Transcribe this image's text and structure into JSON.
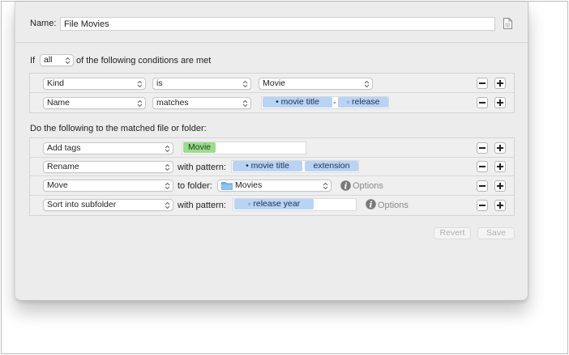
{
  "header": {
    "name_label": "Name:",
    "name_value": "File Movies",
    "doc_icon": "document-icon"
  },
  "conditions": {
    "prefix": "If",
    "match_select": "all",
    "suffix": "of the following conditions are met",
    "rows": [
      {
        "attribute": "Kind",
        "operator": "is",
        "value": "Movie"
      },
      {
        "attribute": "Name",
        "operator": "matches",
        "tokens": [
          "• movie title",
          "release"
        ],
        "separator": "-"
      }
    ]
  },
  "actions": {
    "heading": "Do the following to the matched file or folder:",
    "rows": [
      {
        "action": "Add tags",
        "tag": "Movie"
      },
      {
        "action": "Rename",
        "with_label": "with pattern:",
        "tokens": [
          "• movie title",
          "extension"
        ]
      },
      {
        "action": "Move",
        "to_label": "to folder:",
        "folder": "Movies",
        "options": "Options"
      },
      {
        "action": "Sort into subfolder",
        "with_label": "with pattern:",
        "tokens": [
          "release year"
        ],
        "options": "Options"
      }
    ]
  },
  "footer": {
    "revert": "Revert",
    "save": "Save"
  },
  "colors": {
    "token_blue": "#b9d3f5",
    "token_green": "#9bdc8d",
    "window_bg": "#ececec"
  }
}
